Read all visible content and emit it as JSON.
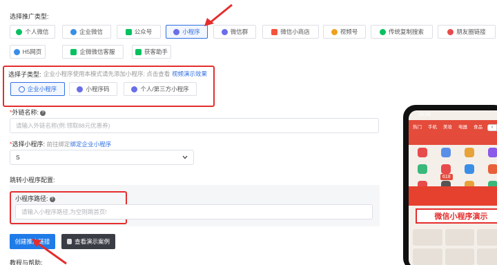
{
  "promo_type": {
    "label": "选择推广类型:",
    "chips": [
      {
        "label": "个人微信",
        "icon": "wechat-icon",
        "color": "#07c160",
        "active": false
      },
      {
        "label": "企业微信",
        "icon": "work-wechat-icon",
        "color": "#3a8ee6",
        "active": false
      },
      {
        "label": "公众号",
        "icon": "official-account-icon",
        "color": "#07c160",
        "active": false
      },
      {
        "label": "小程序",
        "icon": "mini-program-icon",
        "color": "#6a6ee8",
        "active": true
      },
      {
        "label": "微信群",
        "icon": "wechat-group-icon",
        "color": "#6a6ee8",
        "active": false
      },
      {
        "label": "微信小商店",
        "icon": "shop-icon",
        "color": "#f5533d",
        "active": false
      },
      {
        "label": "视频号",
        "icon": "channels-icon",
        "color": "#f0a020",
        "active": false
      },
      {
        "label": "传统复制搜索",
        "icon": "copy-search-icon",
        "color": "#07c160",
        "active": false
      },
      {
        "label": "朋友圈链接",
        "icon": "moments-icon",
        "color": "#e84b4b",
        "active": false
      },
      {
        "label": "H5网页",
        "icon": "h5-icon",
        "color": "#3a8ee6",
        "active": false
      },
      {
        "label": "企微微信客服",
        "icon": "service-icon",
        "color": "#07c160",
        "active": false
      },
      {
        "label": "获客助手",
        "icon": "assistant-icon",
        "color": "#07c160",
        "active": false
      }
    ]
  },
  "sub_type": {
    "label": "选择子类型:",
    "hint": "企业小程序使用本模式请先添加小程序; 点击查看",
    "link": "视频演示效果",
    "chips": [
      {
        "label": "企业小程序",
        "active": true
      },
      {
        "label": "小程序码",
        "active": false
      },
      {
        "label": "个人/第三方小程序",
        "active": false
      }
    ]
  },
  "link_name": {
    "label": "外链名称:",
    "placeholder": "请输入外链名称(例:领取88元优惠券)"
  },
  "select_mp": {
    "label": "选择小程序:",
    "hint": "前往绑定",
    "link": "绑定企业小程序",
    "value": "S"
  },
  "redirect": {
    "label": "跳转小程序配置:",
    "path_label": "小程序路径:",
    "path_placeholder": "请输入小程序路径,为空则跳首页!"
  },
  "buttons": {
    "create": "创建推广链接",
    "demo": "查看演示案例"
  },
  "help_label": "教程与帮助:",
  "phone": {
    "time": "16:29",
    "tabs": [
      "热门",
      "手机",
      "美妆",
      "电器",
      "食品"
    ],
    "badge": "618",
    "banner": "微信小程序演示"
  },
  "colors": {
    "accent": "#2f6fe0",
    "annotation": "#e52d2d",
    "primary_button": "#1f7be8"
  }
}
